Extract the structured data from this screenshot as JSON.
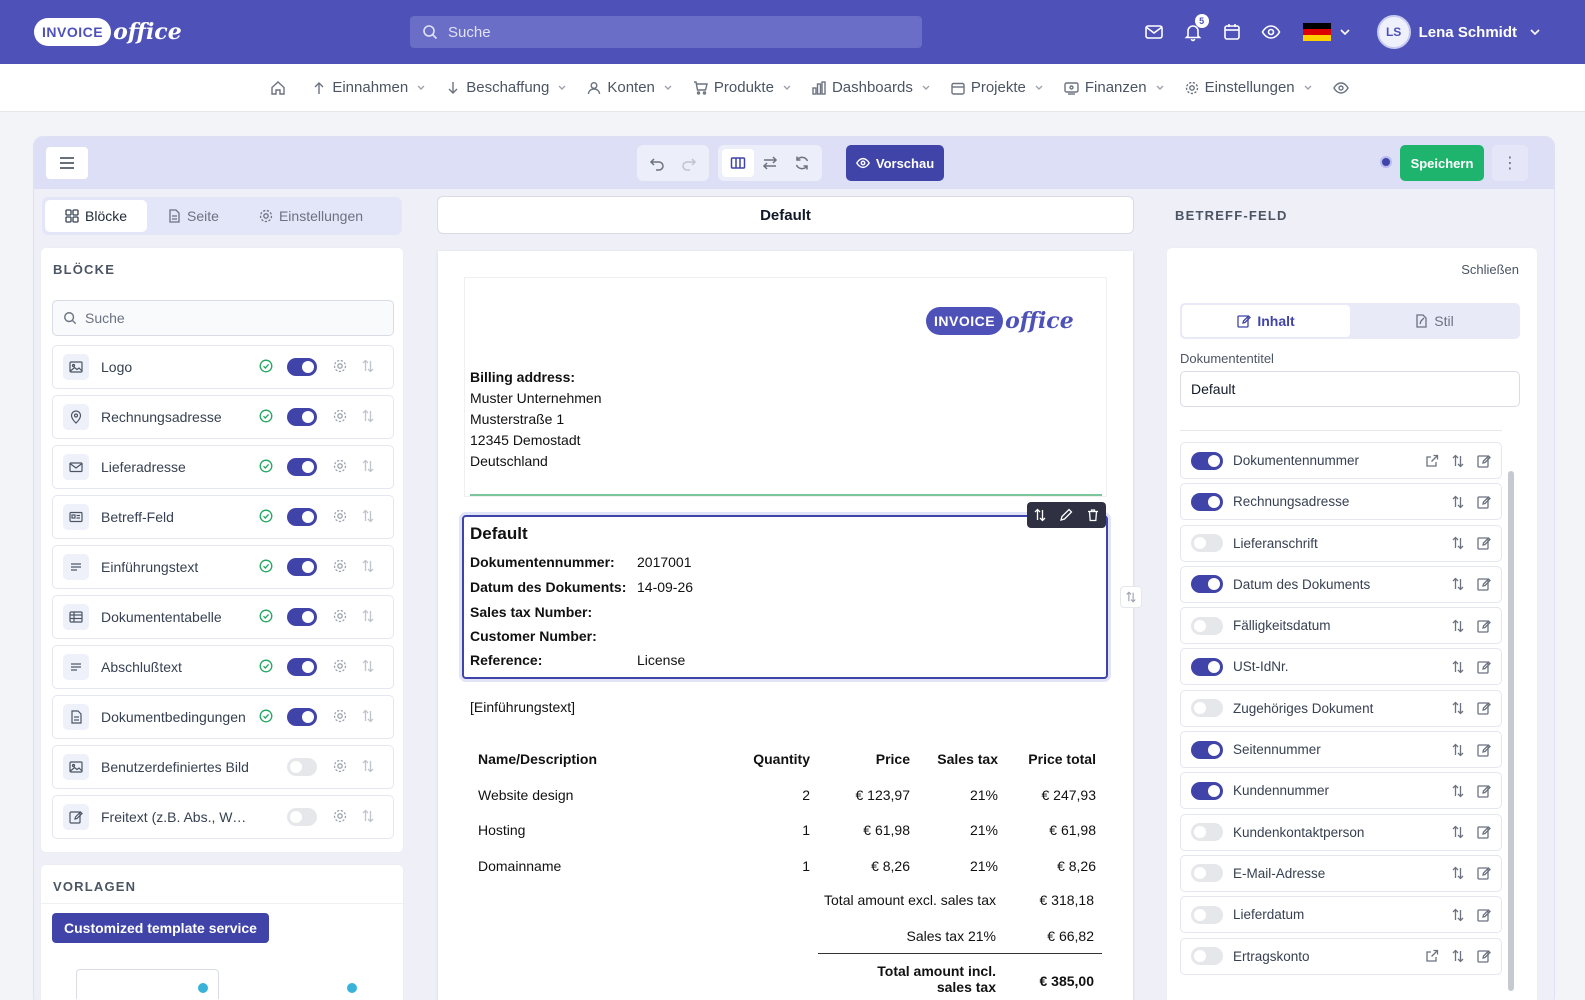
{
  "app": {
    "logo_word": "INVOICE",
    "logo_script": "office",
    "search_placeholder": "Suche",
    "notif_count": "5",
    "user_initials": "LS",
    "user_name": "Lena Schmidt",
    "brand_color": "#4e52b8"
  },
  "menu": [
    {
      "label": "Einnahmen",
      "icon": "arrow-up-icon"
    },
    {
      "label": "Beschaffung",
      "icon": "arrow-down-icon"
    },
    {
      "label": "Konten",
      "icon": "user-icon"
    },
    {
      "label": "Produkte",
      "icon": "cart-icon"
    },
    {
      "label": "Dashboards",
      "icon": "chart-icon"
    },
    {
      "label": "Projekte",
      "icon": "calendar-icon"
    },
    {
      "label": "Finanzen",
      "icon": "finance-icon"
    },
    {
      "label": "Einstellungen",
      "icon": "gear-icon"
    }
  ],
  "toolbar": {
    "preview_label": "Vorschau",
    "save_label": "Speichern"
  },
  "left": {
    "tabs": [
      "Blöcke",
      "Seite",
      "Einstellungen"
    ],
    "blocks_title": "BLÖCKE",
    "search_placeholder": "Suche",
    "blocks": [
      {
        "label": "Logo",
        "on": true
      },
      {
        "label": "Rechnungsadresse",
        "on": true
      },
      {
        "label": "Lieferadresse",
        "on": true
      },
      {
        "label": "Betreff-Feld",
        "on": true
      },
      {
        "label": "Einführungstext",
        "on": true
      },
      {
        "label": "Dokumententabelle",
        "on": true
      },
      {
        "label": "Abschlußtext",
        "on": true
      },
      {
        "label": "Dokumentbedingungen",
        "on": true
      },
      {
        "label": "Benutzerdefiniertes Bild",
        "on": false
      },
      {
        "label": "Freitext (z.B. Abs., Werbetext)",
        "on": false
      }
    ],
    "templates_title": "VORLAGEN",
    "template_service_label": "Customized template service"
  },
  "document": {
    "title": "Default",
    "billing_heading": "Billing address:",
    "address_lines": [
      "Muster Unternehmen",
      "Musterstraße 1",
      "12345 Demostadt",
      "Deutschland"
    ],
    "subject_title": "Default",
    "subject_rows": [
      {
        "key": "Dokumentennummer:",
        "value": "2017001"
      },
      {
        "key": "Datum des Dokuments:",
        "value": "14-09-26"
      },
      {
        "key": "Sales tax Number:",
        "value": ""
      },
      {
        "key": "Customer Number:",
        "value": ""
      },
      {
        "key": "Reference:",
        "value": "License"
      }
    ],
    "intro_placeholder": "[Einführungstext]",
    "table_headers": [
      "Name/Description",
      "Quantity",
      "Price",
      "Sales tax",
      "Price total"
    ],
    "table_rows": [
      [
        "Website design",
        "2",
        "€ 123,97",
        "21%",
        "€ 247,93"
      ],
      [
        "Hosting",
        "1",
        "€ 61,98",
        "21%",
        "€ 61,98"
      ],
      [
        "Domainname",
        "1",
        "€ 8,26",
        "21%",
        "€ 8,26"
      ]
    ],
    "totals": [
      {
        "label": "Total amount excl. sales tax",
        "value": "€ 318,18"
      },
      {
        "label": "Sales tax 21%",
        "value": "€ 66,82"
      },
      {
        "label": "Total amount incl. sales tax",
        "value": "€ 385,00"
      }
    ]
  },
  "right": {
    "heading": "BETREFF-FELD",
    "close_label": "Schließen",
    "tabs": [
      "Inhalt",
      "Stil"
    ],
    "doc_title_label": "Dokumententitel",
    "doc_title_value": "Default",
    "fields": [
      {
        "label": "Dokumentennummer",
        "on": true,
        "external": true
      },
      {
        "label": "Rechnungsadresse",
        "on": true,
        "external": false
      },
      {
        "label": "Lieferanschrift",
        "on": false,
        "external": false
      },
      {
        "label": "Datum des Dokuments",
        "on": true,
        "external": false
      },
      {
        "label": "Fälligkeitsdatum",
        "on": false,
        "external": false
      },
      {
        "label": "USt-IdNr.",
        "on": true,
        "external": false
      },
      {
        "label": "Zugehöriges Dokument",
        "on": false,
        "external": false
      },
      {
        "label": "Seitennummer",
        "on": true,
        "external": false
      },
      {
        "label": "Kundennummer",
        "on": true,
        "external": false
      },
      {
        "label": "Kundenkontaktperson",
        "on": false,
        "external": false
      },
      {
        "label": "E-Mail-Adresse",
        "on": false,
        "external": false
      },
      {
        "label": "Lieferdatum",
        "on": false,
        "external": false
      },
      {
        "label": "Ertragskonto",
        "on": false,
        "external": true
      }
    ]
  }
}
